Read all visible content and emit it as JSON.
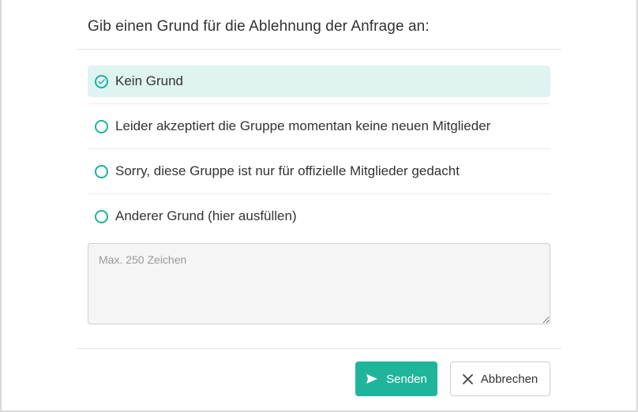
{
  "dialog": {
    "title": "Gib einen Grund für die Ablehnung der Anfrage an:",
    "options": [
      {
        "label": "Kein Grund",
        "selected": true
      },
      {
        "label": "Leider akzeptiert die Gruppe momentan keine neuen Mitglieder",
        "selected": false
      },
      {
        "label": "Sorry, diese Gruppe ist nur für offizielle Mitglieder gedacht",
        "selected": false
      },
      {
        "label": "Anderer Grund (hier ausfüllen)",
        "selected": false
      }
    ],
    "reason_input": {
      "value": "",
      "placeholder": "Max. 250 Zeichen"
    },
    "send_label": "Senden",
    "cancel_label": "Abbrechen"
  },
  "colors": {
    "accent": "#1fb59b",
    "selected_bg": "#dff3f1"
  },
  "icons": {
    "selected_radio": "check-circle-icon",
    "radio": "radio-circle-icon",
    "send": "send-icon",
    "cancel": "close-icon"
  }
}
